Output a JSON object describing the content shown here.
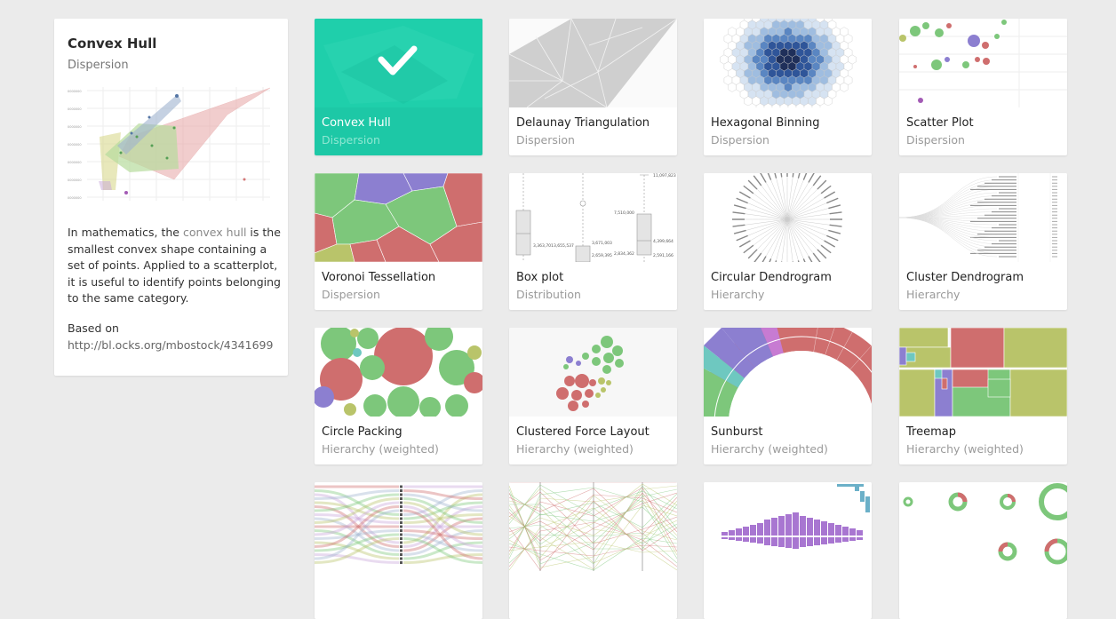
{
  "info": {
    "title": "Convex Hull",
    "category": "Dispersion",
    "desc_pre": "In mathematics, the ",
    "desc_link": "convex hull",
    "desc_post": " is the smallest convex shape containing a set of points. Applied to a scatterplot, it is useful to identify points belonging to the same category.",
    "based_label": "Based on",
    "based_url": "http://bl.ocks.org/mbostock/4341699"
  },
  "cards": [
    {
      "title": "Convex Hull",
      "category": "Dispersion",
      "selected": true
    },
    {
      "title": "Delaunay Triangulation",
      "category": "Dispersion"
    },
    {
      "title": "Hexagonal Binning",
      "category": "Dispersion"
    },
    {
      "title": "Scatter Plot",
      "category": "Dispersion"
    },
    {
      "title": "Voronoi Tessellation",
      "category": "Dispersion"
    },
    {
      "title": "Box plot",
      "category": "Distribution"
    },
    {
      "title": "Circular Dendrogram",
      "category": "Hierarchy"
    },
    {
      "title": "Cluster Dendrogram",
      "category": "Hierarchy"
    },
    {
      "title": "Circle Packing",
      "category": "Hierarchy (weighted)"
    },
    {
      "title": "Clustered Force Layout",
      "category": "Hierarchy (weighted)"
    },
    {
      "title": "Sunburst",
      "category": "Hierarchy (weighted)"
    },
    {
      "title": "Treemap",
      "category": "Hierarchy (weighted)"
    },
    {
      "title": "",
      "category": ""
    },
    {
      "title": "",
      "category": ""
    },
    {
      "title": "",
      "category": ""
    },
    {
      "title": "",
      "category": ""
    }
  ],
  "boxplot_labels": [
    "11,097,823",
    "7,510,000",
    "3,363,701",
    "3,655,537",
    "3,671,003",
    "4,399,664",
    "2,659,395",
    "2,834,362",
    "2,591,166"
  ],
  "colors": {
    "accent": "#1dc8a6",
    "green": "#7dc77b",
    "red": "#cf6e6e",
    "purple": "#8c7fd0",
    "olive": "#b9c46a",
    "teal": "#6ec8c0"
  }
}
